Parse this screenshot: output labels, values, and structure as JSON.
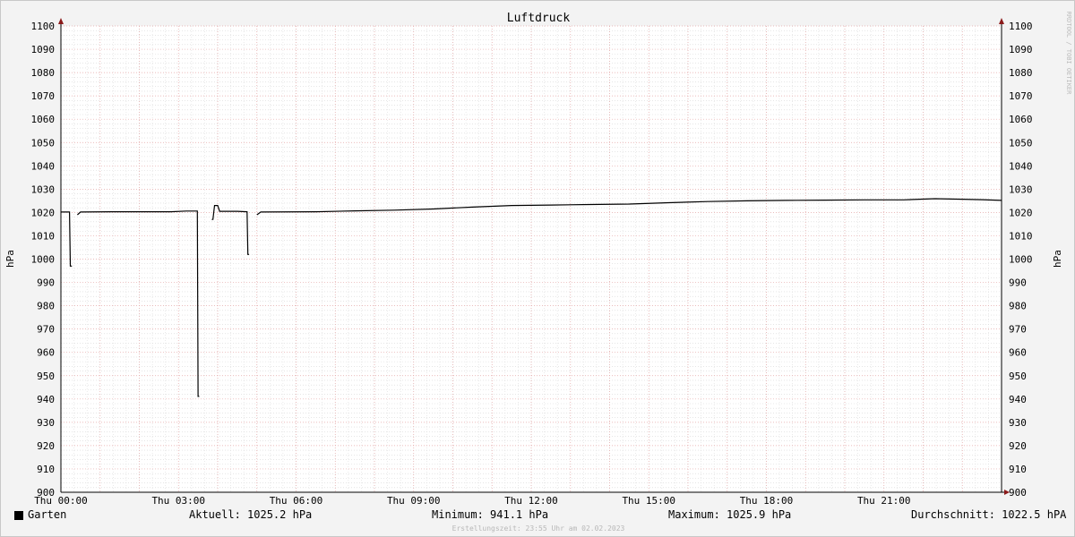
{
  "chart_data": {
    "type": "line",
    "title": "Luftdruck",
    "ylabel_left": "hPa",
    "ylabel_right": "hPa",
    "ylim": [
      900,
      1100
    ],
    "ytick_step": 10,
    "xlim_hours": [
      0,
      24
    ],
    "xtick_labels": [
      "Thu 00:00",
      "Thu 03:00",
      "Thu 06:00",
      "Thu 09:00",
      "Thu 12:00",
      "Thu 15:00",
      "Thu 18:00",
      "Thu 21:00"
    ],
    "xtick_hours": [
      0,
      3,
      6,
      9,
      12,
      15,
      18,
      21
    ],
    "grid": true,
    "watermark": "RRDTOOL / TOBI OETIKER",
    "series": [
      {
        "name": "Garten",
        "color": "#000000",
        "segments": [
          [
            [
              0.0,
              1020.2
            ],
            [
              0.22,
              1020.2
            ],
            [
              0.24,
              997
            ],
            [
              0.28,
              997
            ]
          ],
          [
            [
              0.42,
              1019
            ],
            [
              0.5,
              1020.2
            ],
            [
              1.3,
              1020.3
            ],
            [
              2.0,
              1020.3
            ],
            [
              2.8,
              1020.3
            ],
            [
              3.2,
              1020.6
            ],
            [
              3.48,
              1020.6
            ],
            [
              3.5,
              941.1
            ],
            [
              3.53,
              941.1
            ]
          ],
          [
            [
              3.85,
              1017
            ],
            [
              3.88,
              1017
            ],
            [
              3.92,
              1023
            ],
            [
              4.0,
              1023
            ],
            [
              4.05,
              1020.5
            ],
            [
              4.5,
              1020.5
            ],
            [
              4.75,
              1020.3
            ],
            [
              4.77,
              1002
            ],
            [
              4.8,
              1002
            ]
          ],
          [
            [
              5.0,
              1019
            ],
            [
              5.1,
              1020.2
            ],
            [
              6.5,
              1020.3
            ],
            [
              7.5,
              1020.7
            ],
            [
              8.5,
              1021
            ],
            [
              9.5,
              1021.5
            ],
            [
              10.5,
              1022.3
            ],
            [
              11.5,
              1023
            ],
            [
              12.5,
              1023.2
            ],
            [
              13.5,
              1023.4
            ],
            [
              14.5,
              1023.6
            ],
            [
              15.5,
              1024.2
            ],
            [
              16.5,
              1024.7
            ],
            [
              17.5,
              1025
            ],
            [
              18.5,
              1025.2
            ],
            [
              19.5,
              1025.3
            ],
            [
              20.5,
              1025.4
            ],
            [
              21.5,
              1025.4
            ],
            [
              22.3,
              1025.9
            ],
            [
              23.0,
              1025.7
            ],
            [
              23.5,
              1025.5
            ],
            [
              24.0,
              1025.2
            ]
          ]
        ]
      }
    ]
  },
  "legend": {
    "series_name": "Garten",
    "aktuell": "Aktuell: 1025.2 hPa",
    "minimum": "Minimum: 941.1 hPa",
    "maximum": "Maximum: 1025.9 hPa",
    "durchschnitt": "Durchschnitt: 1022.5 hPA"
  },
  "footer": "Erstellungszeit: 23:55 Uhr am 02.02.2023"
}
